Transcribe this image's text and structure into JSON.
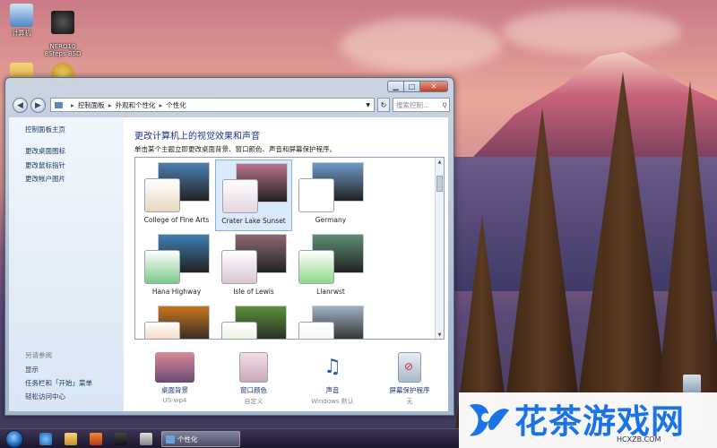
{
  "desktop": {
    "icons": [
      {
        "label": "计算机",
        "icon": "computer-icon"
      },
      {
        "label": "NERO10\n8Steps BSD",
        "icon": "nero-icon"
      }
    ]
  },
  "window": {
    "breadcrumb": [
      "控制面板",
      "外观和个性化",
      "个性化"
    ],
    "search_placeholder": "搜索控制...",
    "help_label": "?",
    "sidebar": {
      "home": "控制面板主页",
      "links": [
        "更改桌面图标",
        "更改鼠标指针",
        "更改帐户图片"
      ],
      "see_also_header": "另请参阅",
      "see_also": [
        "显示",
        "任务栏和「开始」菜单",
        "轻松访问中心"
      ]
    },
    "main": {
      "title": "更改计算机上的视觉效果和声音",
      "subtitle": "单击某个主题立即更改桌面背景、窗口颜色、声音和屏幕保护程序。",
      "themes": [
        {
          "label": "College of Fine Arts",
          "selected": false,
          "pic": "#4a7fb3",
          "swatch": "#e8d9c2"
        },
        {
          "label": "Crater Lake Sunset",
          "selected": true,
          "pic": "#b9748a",
          "swatch": "#e7d5e0"
        },
        {
          "label": "Germany",
          "selected": false,
          "pic": "#6f9ac8",
          "swatch": "#ffffff"
        },
        {
          "label": "Hana Highway",
          "selected": false,
          "pic": "#3d7fb2",
          "swatch": "#7dc88a"
        },
        {
          "label": "Isle of Lewis",
          "selected": false,
          "pic": "#8a6a72",
          "swatch": "#d9c7d4"
        },
        {
          "label": "Llanrwst",
          "selected": false,
          "pic": "#5d8f73",
          "swatch": "#8fd889"
        },
        {
          "label": "",
          "selected": false,
          "pic": "#c8741f",
          "swatch": "#e8b98a"
        },
        {
          "label": "",
          "selected": false,
          "pic": "#5a8f3a",
          "swatch": "#dfe8bf"
        },
        {
          "label": "",
          "selected": false,
          "pic": "#9fb0c2",
          "swatch": "#f2f2f2"
        }
      ],
      "bottom": [
        {
          "label": "桌面背景",
          "value": "US-wp4",
          "icon": "desktop-background-icon"
        },
        {
          "label": "窗口颜色",
          "value": "自定义",
          "icon": "window-color-icon"
        },
        {
          "label": "声音",
          "value": "Windows 默认",
          "icon": "sounds-icon"
        },
        {
          "label": "屏幕保护程序",
          "value": "无",
          "icon": "screensaver-icon"
        }
      ]
    }
  },
  "taskbar": {
    "task_label": "个性化"
  },
  "watermark": {
    "text": "花茶游戏网",
    "url": "HCXZB.COM"
  }
}
